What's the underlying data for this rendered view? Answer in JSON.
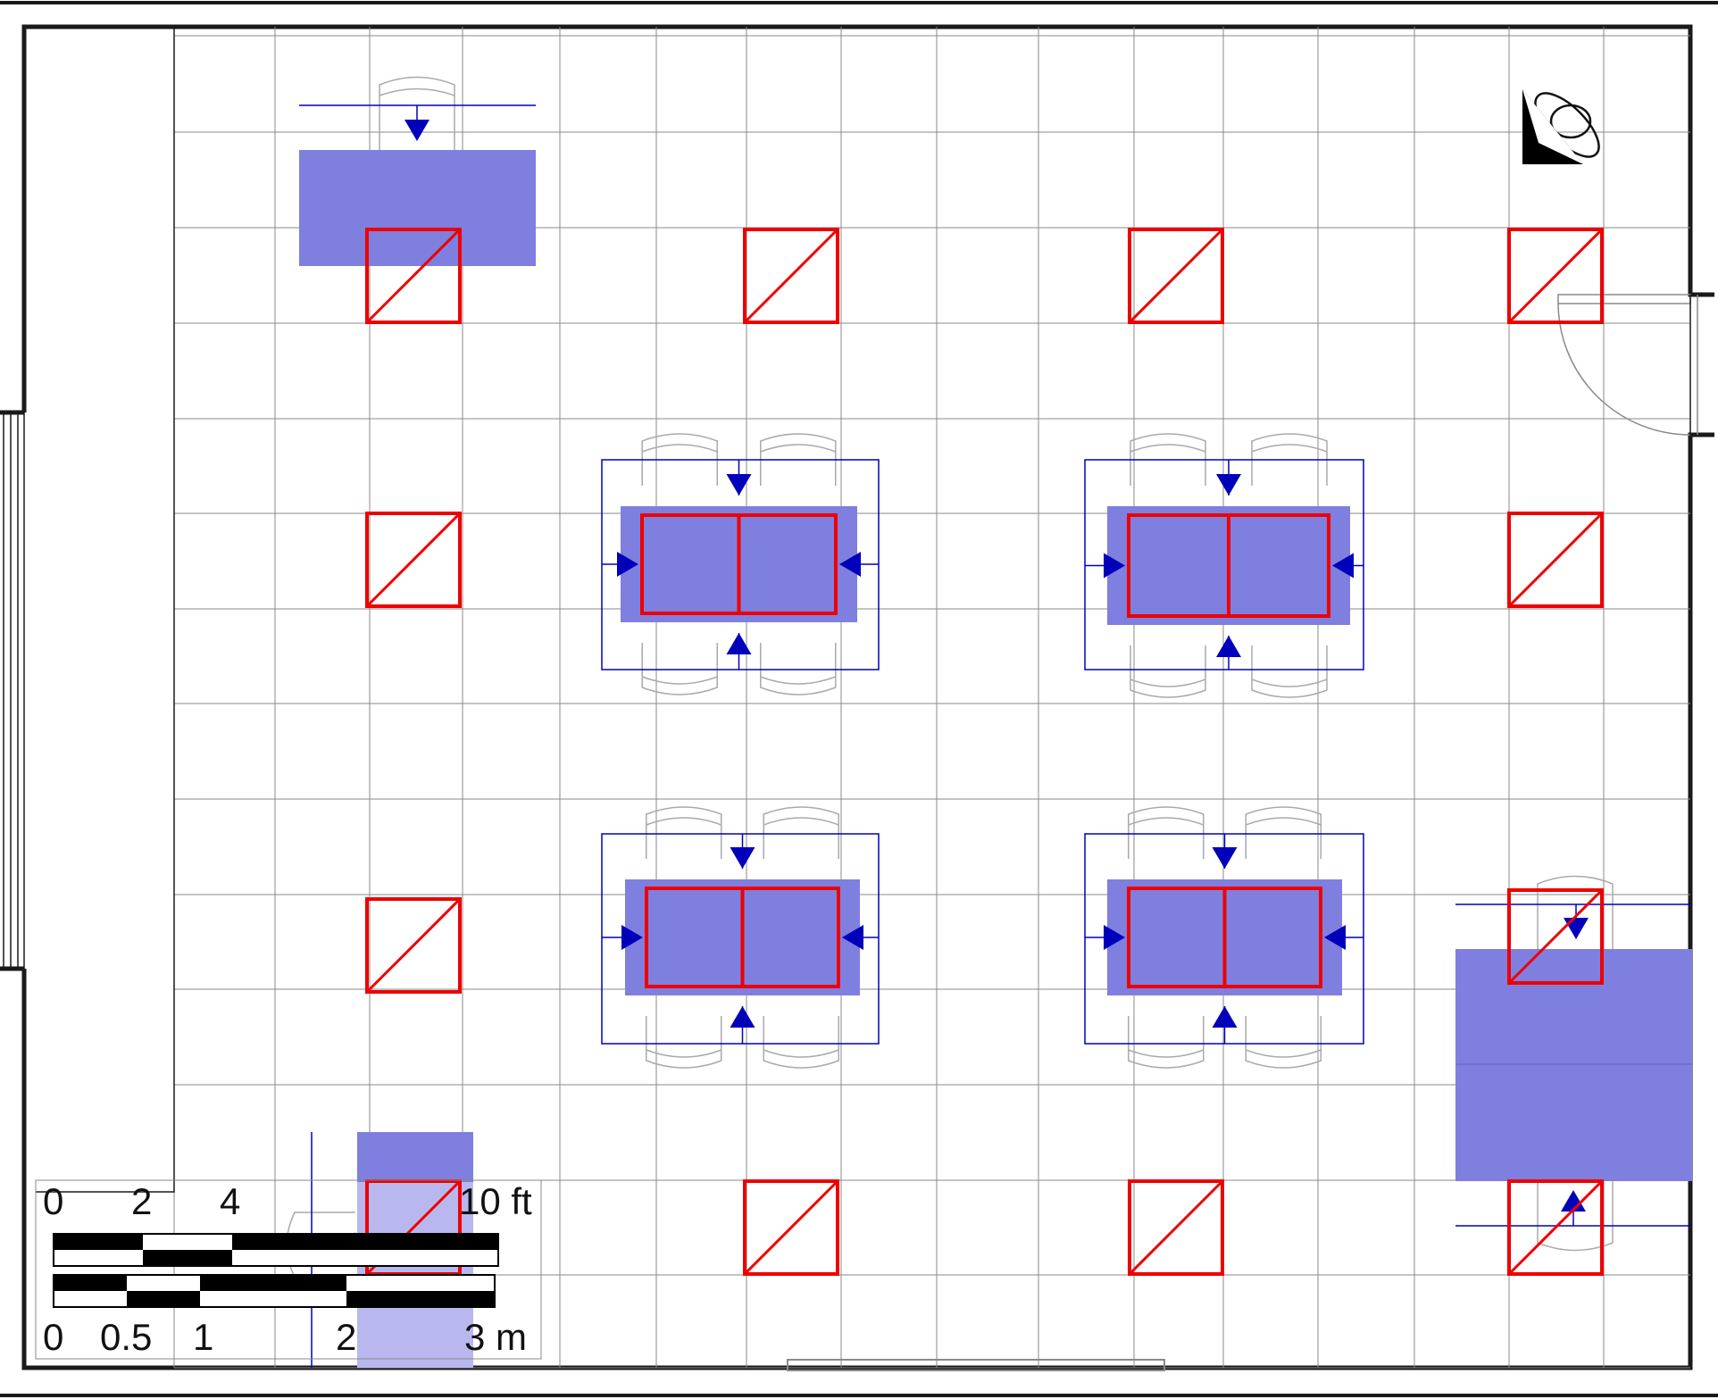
{
  "colors": {
    "wall": "#1a1a1a",
    "grid": "#8a8a8a",
    "furniture_fill": "#7f7fdf",
    "furniture_fill_light": "#b8b8ef",
    "access_zone": "#0000bb",
    "marker": "#ee0000",
    "chair_outline": "#aaaaaa",
    "scale_black": "#000000"
  },
  "scale_bar": {
    "imperial_labels": [
      "0",
      "2",
      "4",
      "10 ft"
    ],
    "metric_labels": [
      "0",
      "0.5",
      "1",
      "2",
      "3 m"
    ]
  },
  "symbols": {
    "compass": "compass-icon",
    "marker": "red-diagonal-square-marker",
    "arrow": "triangle-arrow-icon"
  }
}
